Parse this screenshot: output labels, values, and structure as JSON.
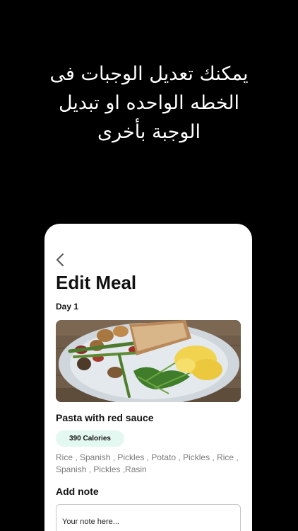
{
  "promo": {
    "headline_lines": [
      "يمكنك تعديل الوجبات فى",
      "الخطه الواحده او تبديل",
      "الوجبة بأخرى"
    ]
  },
  "screen": {
    "back_icon": "chevron-left-icon",
    "title": "Edit Meal",
    "day_label": "Day 1",
    "meal": {
      "name": "Pasta with red sauce",
      "calories": "390 Calories",
      "ingredients": "Rice , Spanish , Pickles , Potato , Pickles , Rice , Spanish , Pickles ,Rasin"
    },
    "note": {
      "label": "Add note",
      "placeholder": "Your note here..."
    }
  },
  "colors": {
    "background": "#000000",
    "card": "#ffffff",
    "calories_badge": "#e3f8f0",
    "muted_text": "#7a7a7a"
  }
}
